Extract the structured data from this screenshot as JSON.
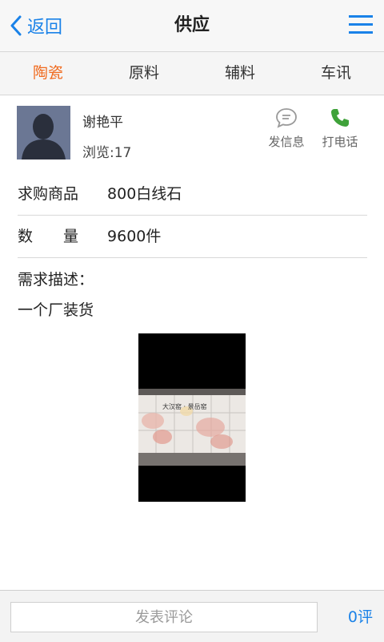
{
  "header": {
    "back_label": "返回",
    "title": "供应"
  },
  "tabs": [
    {
      "label": "陶瓷",
      "active": true
    },
    {
      "label": "原料",
      "active": false
    },
    {
      "label": "辅料",
      "active": false
    },
    {
      "label": "车讯",
      "active": false
    }
  ],
  "user": {
    "name": "谢艳平",
    "views": "浏览:17"
  },
  "actions": {
    "message_label": "发信息",
    "call_label": "打电话"
  },
  "fields": [
    {
      "label": "求购商品",
      "value": "800白线石"
    },
    {
      "label": "数　　量",
      "value": "9600件"
    }
  ],
  "description": {
    "label": "需求描述：",
    "text": "一个厂装货"
  },
  "image_overlay_text": "大汉窑 · 景岳窑",
  "bottom_bar": {
    "comment_placeholder": "发表评论",
    "comment_count": "0评"
  },
  "colors": {
    "accent_blue": "#1a82e8",
    "active_tab": "#f06a1e",
    "call_green": "#3fa23a"
  },
  "icons": [
    "chevron-left-icon",
    "menu-icon",
    "chat-bubble-icon",
    "phone-icon"
  ]
}
